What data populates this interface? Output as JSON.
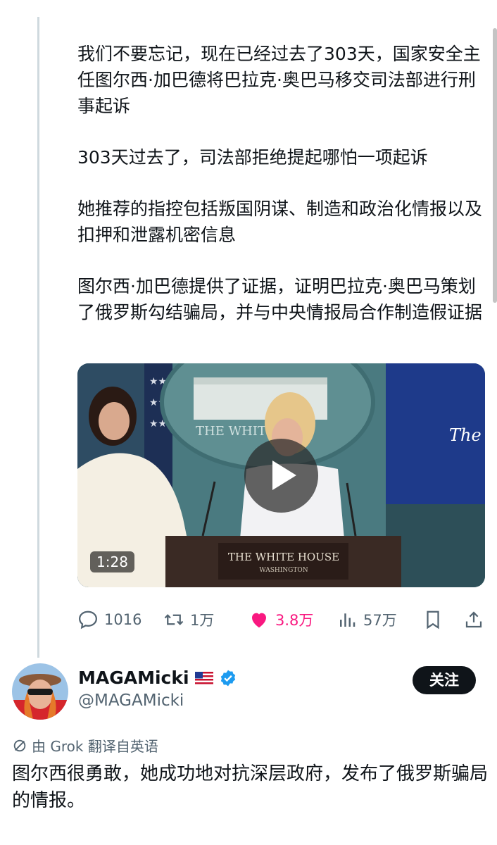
{
  "tweet": {
    "paragraphs": [
      "我们不要忘记，现在已经过去了303天，国家安全主任图尔西·加巴德将巴拉克·奥巴马移交司法部进行刑事起诉",
      "303天过去了，司法部拒绝提起哪怕一项起诉",
      "她推荐的指控包括叛国阴谋、制造和政治化情报以及扣押和泄露机密信息",
      "图尔西·加巴德提供了证据，证明巴拉克·奥巴马策划了俄罗斯勾结骗局，并与中央情报局合作制造假证据"
    ],
    "video": {
      "duration": "1:28",
      "podium_text": "THE WHITE HOUSE",
      "podium_subtext": "WASHINGTON",
      "backdrop_text": "THE WHITE",
      "right_screen_text": "The W"
    },
    "actions": {
      "replies": "1016",
      "retweets": "1万",
      "likes": "3.8万",
      "views": "57万",
      "like_color": "#f91880",
      "icons": [
        "reply-icon",
        "retweet-icon",
        "heart-icon",
        "views-icon",
        "bookmark-icon",
        "share-icon"
      ]
    }
  },
  "reply": {
    "display_name": "MAGAMicki",
    "handle": "@MAGAMicki",
    "follow_label": "关注",
    "verified_color": "#1d9bf0",
    "translation_note": "由 Grok 翻译自英语",
    "text": "图尔西很勇敢，她成功地对抗深层政府，发布了俄罗斯骗局的情报。"
  }
}
